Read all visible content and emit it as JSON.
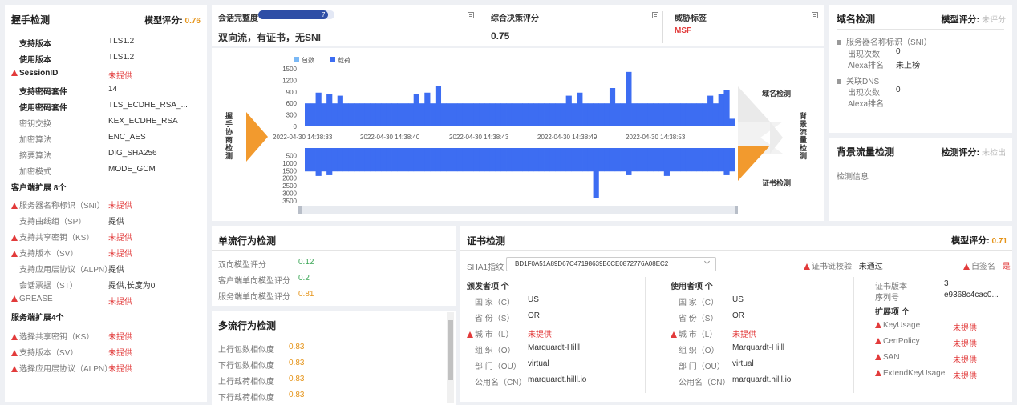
{
  "handshake": {
    "title": "握手检测",
    "score_label": "模型评分:",
    "score": "0.76",
    "rows": [
      {
        "label": "支持版本",
        "value": "TLS1.2",
        "bold": true,
        "warn": false,
        "vcolor": ""
      },
      {
        "label": "使用版本",
        "value": "TLS1.2",
        "bold": true,
        "warn": false,
        "vcolor": ""
      },
      {
        "label": "SessionID",
        "value": "未提供",
        "bold": true,
        "warn": true,
        "vcolor": "red"
      },
      {
        "label": "支持密码套件",
        "value": "14",
        "bold": true,
        "warn": false,
        "vcolor": ""
      },
      {
        "label": "使用密码套件",
        "value": "TLS_ECDHE_RSA_...",
        "bold": true,
        "warn": false,
        "vcolor": ""
      },
      {
        "label": "密钥交换",
        "value": "KEX_ECDHE_RSA",
        "bold": false,
        "warn": false,
        "vcolor": ""
      },
      {
        "label": "加密算法",
        "value": "ENC_AES",
        "bold": false,
        "warn": false,
        "vcolor": ""
      },
      {
        "label": "摘要算法",
        "value": "DIG_SHA256",
        "bold": false,
        "warn": false,
        "vcolor": ""
      },
      {
        "label": "加密模式",
        "value": "MODE_GCM",
        "bold": false,
        "warn": false,
        "vcolor": ""
      }
    ],
    "client_ext_title": "客户端扩展 8个",
    "client_ext": [
      {
        "label": "服务器名称标识（SNI）",
        "value": "未提供",
        "warn": true,
        "red": true
      },
      {
        "label": "支持曲线组（SP）",
        "value": "提供",
        "warn": false,
        "red": false
      },
      {
        "label": "支持共享密钥（KS）",
        "value": "未提供",
        "warn": true,
        "red": true
      },
      {
        "label": "支持版本（SV）",
        "value": "未提供",
        "warn": true,
        "red": true
      },
      {
        "label": "支持应用层协议（ALPN）",
        "value": "提供",
        "warn": false,
        "red": false
      },
      {
        "label": "会话票据（ST）",
        "value": "提供,长度为0",
        "warn": false,
        "red": false
      },
      {
        "label": "GREASE",
        "value": "未提供",
        "warn": true,
        "red": true
      }
    ],
    "server_ext_title": "服务端扩展4个",
    "server_ext": [
      {
        "label": "选择共享密钥（KS）",
        "value": "未提供"
      },
      {
        "label": "支持版本（SV）",
        "value": "未提供"
      },
      {
        "label": "选择应用层协议（ALPN）",
        "value": "未提供"
      }
    ]
  },
  "session": {
    "integrity_label": "会话完整度",
    "integrity_value": "7",
    "integrity_percent": 92,
    "desc": "双向流，有证书，无SNI",
    "decision_label": "综合决策评分",
    "decision_value": "0.75",
    "threat_label": "威胁标签",
    "threat_value": "MSF"
  },
  "chart_data": {
    "type": "bar",
    "legend": [
      "包数",
      "载荷"
    ],
    "colors": {
      "packets": "#7ab8f5",
      "payload": "#3d6df2"
    },
    "x_labels": [
      "2022-04-30 14:38:33",
      "2022-04-30 14:38:40",
      "2022-04-30 14:38:43",
      "2022-04-30 14:38:49",
      "2022-04-30 14:38:53"
    ],
    "upper_yticks": [
      "1500",
      "1200",
      "900",
      "600",
      "300",
      "0"
    ],
    "lower_yticks": [
      "500",
      "1000",
      "1500",
      "2000",
      "2500",
      "3000",
      "3500"
    ],
    "upper_ylim": [
      0,
      1500
    ],
    "lower_ylim": [
      0,
      3500
    ],
    "upper": [
      600,
      600,
      880,
      600,
      850,
      600,
      800,
      600,
      600,
      600,
      600,
      600,
      600,
      600,
      600,
      600,
      600,
      600,
      600,
      600,
      850,
      600,
      880,
      600,
      1050,
      600,
      600,
      600,
      600,
      600,
      600,
      600,
      600,
      600,
      600,
      600,
      600,
      600,
      600,
      600,
      600,
      600,
      600,
      600,
      600,
      600,
      600,
      600,
      800,
      600,
      880,
      600,
      600,
      600,
      600,
      600,
      1000,
      600,
      600,
      1420,
      600,
      600,
      600,
      600,
      600,
      600,
      600,
      600,
      600,
      600,
      600,
      600,
      600,
      600,
      800,
      600,
      850,
      950,
      200
    ],
    "lower": [
      1550,
      1550,
      1850,
      1550,
      1800,
      1550,
      1550,
      1550,
      1550,
      1550,
      1550,
      1550,
      1550,
      1550,
      1550,
      1550,
      1550,
      1550,
      1550,
      1550,
      1550,
      1550,
      1550,
      1550,
      1550,
      1550,
      1550,
      1550,
      1550,
      1550,
      1550,
      1550,
      1550,
      1550,
      1550,
      1550,
      1550,
      1550,
      1550,
      1550,
      1550,
      1550,
      1550,
      1550,
      1550,
      1550,
      1550,
      1550,
      1550,
      1550,
      1550,
      1550,
      1550,
      3300,
      1550,
      1550,
      1550,
      1550,
      1550,
      1800,
      1550,
      1550,
      1550,
      1550,
      1550,
      1550,
      1850,
      1550,
      1550,
      1550,
      1550,
      1550,
      1550,
      1550,
      1550,
      1550,
      1550,
      1800,
      1550
    ]
  },
  "flow_labels": {
    "handshake": "握手协商检测",
    "domain": "域名检测",
    "background": "背景流量检测",
    "cert": "证书检测"
  },
  "domain": {
    "title": "域名检测",
    "score_label": "模型评分:",
    "score": "未评分",
    "sni_title": "服务器名称标识（SNI）",
    "sni_count_label": "出现次数",
    "sni_count": "0",
    "sni_rank_label": "Alexa排名",
    "sni_rank": "未上榜",
    "dns_title": "关联DNS",
    "dns_count_label": "出现次数",
    "dns_count": "0",
    "dns_rank_label": "Alexa排名"
  },
  "background": {
    "title": "背景流量检测",
    "score_label": "检测评分:",
    "score": "未检出",
    "info": "检测信息"
  },
  "single": {
    "title": "单流行为检测",
    "rows": [
      {
        "label": "双向模型评分",
        "value": "0.12",
        "color": "green"
      },
      {
        "label": "客户端单向模型评分",
        "value": "0.2",
        "color": "green"
      },
      {
        "label": "服务端单向模型评分",
        "value": "0.81",
        "color": "orange"
      }
    ]
  },
  "multi": {
    "title": "多流行为检测",
    "rows": [
      {
        "label": "上行包数相似度",
        "value": "0.83"
      },
      {
        "label": "下行包数相似度",
        "value": "0.83"
      },
      {
        "label": "上行载荷相似度",
        "value": "0.83"
      },
      {
        "label": "下行载荷相似度",
        "value": "0.83"
      }
    ]
  },
  "cert": {
    "title": "证书检测",
    "score_label": "模型评分:",
    "score": "0.71",
    "sha1_label": "SHA1指纹",
    "sha1_value": "BD1F0A51A89D67C47198639B6CE0872776A08EC2",
    "chain_label": "证书链校验",
    "chain_value": "未通过",
    "selfsign_label": "自签名",
    "selfsign_value": "是",
    "issuer_title": "颁发者项 个",
    "subject_title": "使用者项 个",
    "issuer": [
      {
        "label": "国 家（C）",
        "value": "US",
        "warn": false
      },
      {
        "label": "省 份（S）",
        "value": "OR",
        "warn": false
      },
      {
        "label": "城 市（L）",
        "value": "未提供",
        "warn": true
      },
      {
        "label": "组 织（O）",
        "value": "Marquardt-Hilll",
        "warn": false
      },
      {
        "label": "部 门（OU）",
        "value": "virtual",
        "warn": false
      },
      {
        "label": "公用名（CN）",
        "value": "marquardt.hilll.io",
        "warn": false
      }
    ],
    "subject": [
      {
        "label": "国 家（C）",
        "value": "US",
        "warn": false
      },
      {
        "label": "省 份（S）",
        "value": "OR",
        "warn": false
      },
      {
        "label": "城 市（L）",
        "value": "未提供",
        "warn": true
      },
      {
        "label": "组 织（O）",
        "value": "Marquardt-Hilll",
        "warn": false
      },
      {
        "label": "部 门（OU）",
        "value": "virtual",
        "warn": false
      },
      {
        "label": "公用名（CN）",
        "value": "marquardt.hilll.io",
        "warn": false
      }
    ],
    "version_label": "证书版本",
    "version": "3",
    "serial_label": "序列号",
    "serial": "e9368c4cac0...",
    "ext_title": "扩展项 个",
    "ext": [
      {
        "label": "KeyUsage",
        "value": "未提供"
      },
      {
        "label": "CertPolicy",
        "value": "未提供"
      },
      {
        "label": "SAN",
        "value": "未提供"
      },
      {
        "label": "ExtendKeyUsage",
        "value": "未提供"
      }
    ]
  }
}
